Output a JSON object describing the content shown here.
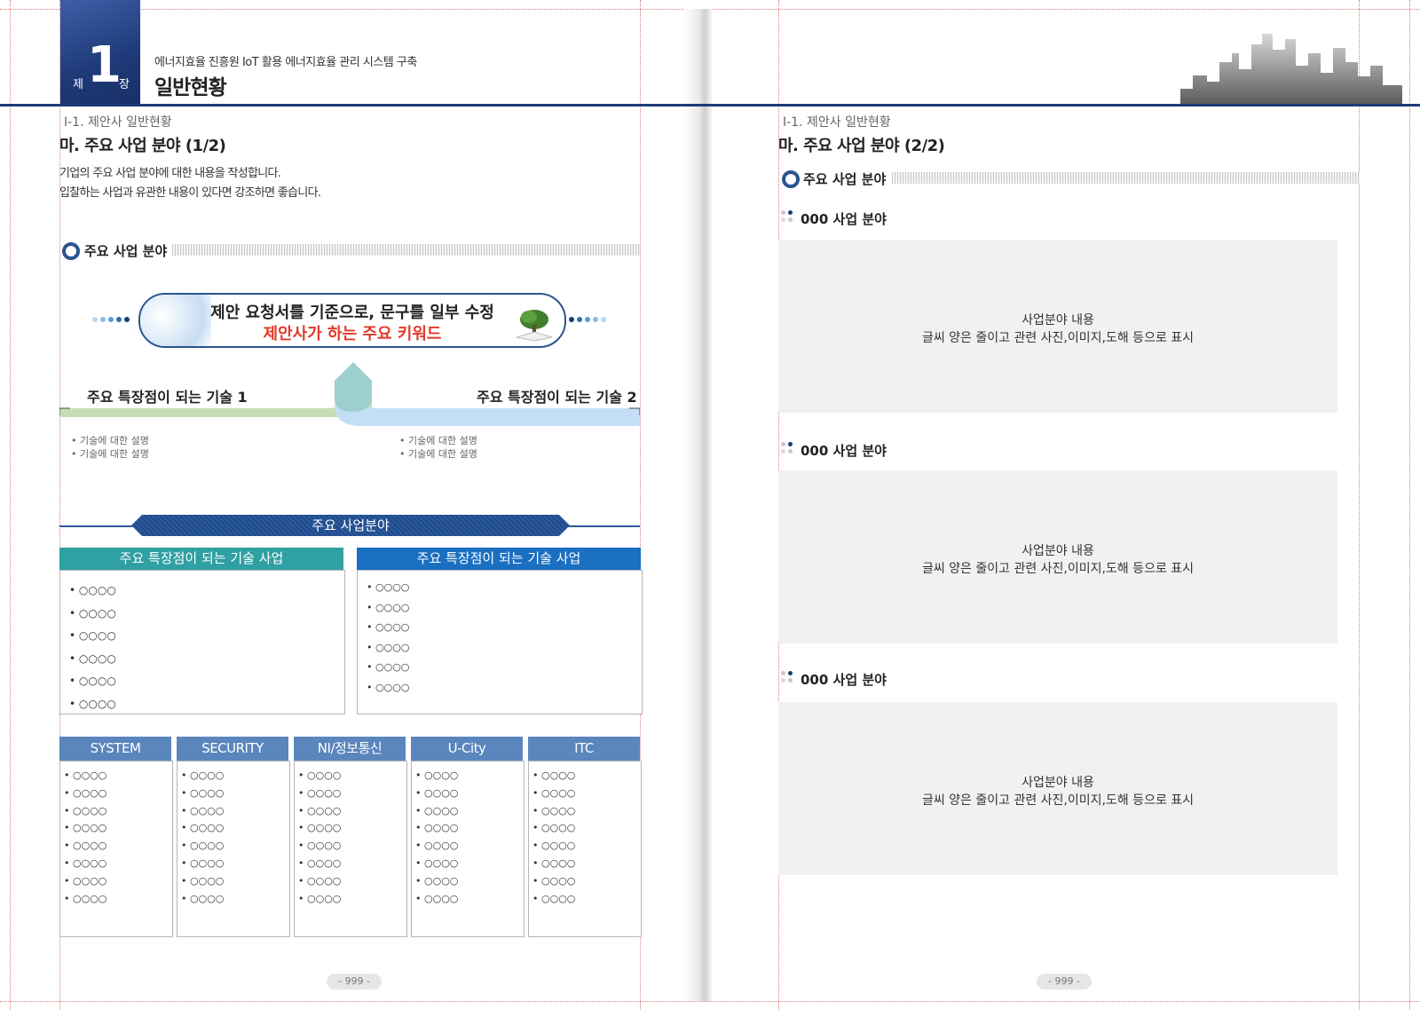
{
  "header": {
    "chapter_prefix": "제",
    "chapter_number": "1",
    "chapter_suffix": "장",
    "project_title": "에너지효율 진흥원 IoT 활용 에너지효율 관리 시스템 구축",
    "chapter_title": "일반현황"
  },
  "left_page": {
    "breadcrumb": "Ⅰ-1. 제안사 일반현황",
    "section_title": "마. 주요 사업 분야 (1/2)",
    "description": [
      "기업의 주요 사업 분야에 대한 내용을 작성합니다.",
      "입찰하는 사업과 유관한 내용이 있다면 강조하면 좋습니다."
    ],
    "subhead": "주요 사업 분야",
    "keyword_line1": "제안 요청서를 기준으로, 문구를 일부 수정",
    "keyword_line2": "제안사가 하는 주요 키워드",
    "tech1_title": "주요 특장점이 되는 기술 1",
    "tech2_title": "주요 특장점이 되는 기술 2",
    "tech1_bullets": [
      "기술에 대한 설명",
      "기술에 대한 설명"
    ],
    "tech2_bullets": [
      "기술에 대한 설명",
      "기술에 대한 설명"
    ],
    "banner": "주요 사업분야",
    "box1": {
      "title": "주요 특장점이 되는 기술 사업",
      "color": "#2fa0a4",
      "items": [
        "○○○○",
        "○○○○",
        "○○○○",
        "○○○○",
        "○○○○",
        "○○○○"
      ]
    },
    "box2": {
      "title": "주요 특장점이 되는 기술 사업",
      "color": "#1a6fc0",
      "items": [
        "○○○○",
        "○○○○",
        "○○○○",
        "○○○○",
        "○○○○",
        "○○○○"
      ]
    },
    "columns": [
      {
        "name": "SYSTEM",
        "items": [
          "○○○○",
          "○○○○",
          "○○○○",
          "○○○○",
          "○○○○",
          "○○○○",
          "○○○○",
          "○○○○"
        ]
      },
      {
        "name": "SECURITY",
        "items": [
          "○○○○",
          "○○○○",
          "○○○○",
          "○○○○",
          "○○○○",
          "○○○○",
          "○○○○",
          "○○○○"
        ]
      },
      {
        "name": "NI/정보통신",
        "items": [
          "○○○○",
          "○○○○",
          "○○○○",
          "○○○○",
          "○○○○",
          "○○○○",
          "○○○○",
          "○○○○"
        ]
      },
      {
        "name": "U-City",
        "items": [
          "○○○○",
          "○○○○",
          "○○○○",
          "○○○○",
          "○○○○",
          "○○○○",
          "○○○○",
          "○○○○"
        ]
      },
      {
        "name": "ITC",
        "items": [
          "○○○○",
          "○○○○",
          "○○○○",
          "○○○○",
          "○○○○",
          "○○○○",
          "○○○○",
          "○○○○"
        ]
      }
    ],
    "page_number": "- 999 -"
  },
  "right_page": {
    "breadcrumb": "Ⅰ-1. 제안사 일반현황",
    "section_title": "마. 주요 사업 분야 (2/2)",
    "subhead": "주요 사업 분야",
    "fields": [
      {
        "label": "000 사업 분야",
        "line1": "사업분야 내용",
        "line2": "글씨 양은 줄이고 관련 사진,이미지,도해 등으로 표시"
      },
      {
        "label": "000 사업 분야",
        "line1": "사업분야 내용",
        "line2": "글씨 양은 줄이고 관련 사진,이미지,도해 등으로 표시"
      },
      {
        "label": "000 사업 분야",
        "line1": "사업분야 내용",
        "line2": "글씨 양은 줄이고 관련 사진,이미지,도해 등으로 표시"
      }
    ],
    "page_number": "- 999 -"
  },
  "colors": {
    "navy": "#1e3a78",
    "accent_red": "#e03a2a",
    "teal": "#2fa0a4",
    "blue": "#1a6fc0",
    "column_head": "#5b85bd"
  }
}
